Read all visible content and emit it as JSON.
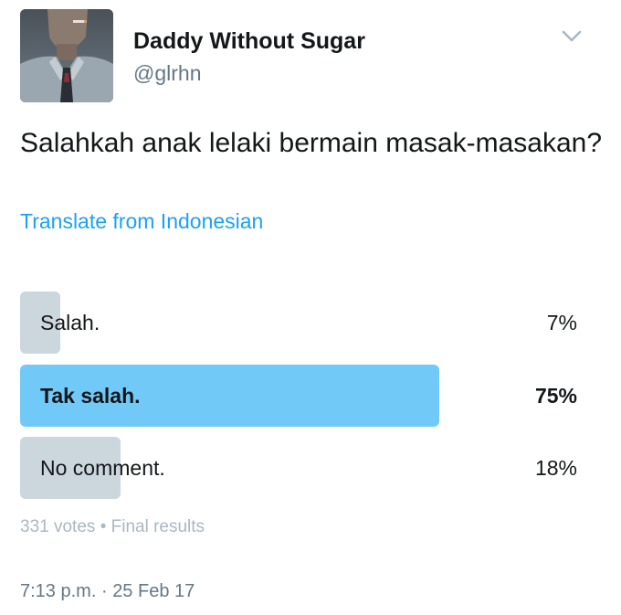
{
  "author": {
    "display_name": "Daddy Without Sugar",
    "handle": "@glrhn"
  },
  "tweet": {
    "text": "Salahkah anak lelaki bermain masak-masakan?",
    "translate_label": "Translate from Indonesian"
  },
  "poll": {
    "options": [
      {
        "label": "Salah.",
        "percent_label": "7%",
        "percent": 7,
        "winner": false
      },
      {
        "label": "Tak salah.",
        "percent_label": "75%",
        "percent": 75,
        "winner": true
      },
      {
        "label": "No comment.",
        "percent_label": "18%",
        "percent": 18,
        "winner": false
      }
    ],
    "votes": "331 votes",
    "separator": "•",
    "status": "Final results"
  },
  "timestamp": {
    "time": "7:13 p.m.",
    "separator": "·",
    "date": "25 Feb 17"
  },
  "colors": {
    "accent": "#1da1f2",
    "winner_bar": "#71c9f8",
    "bar": "#ccd6dd",
    "text": "#14171a",
    "secondary_text": "#657786"
  },
  "icons": {
    "menu": "chevron-down-icon",
    "avatar": "profile-photo"
  }
}
